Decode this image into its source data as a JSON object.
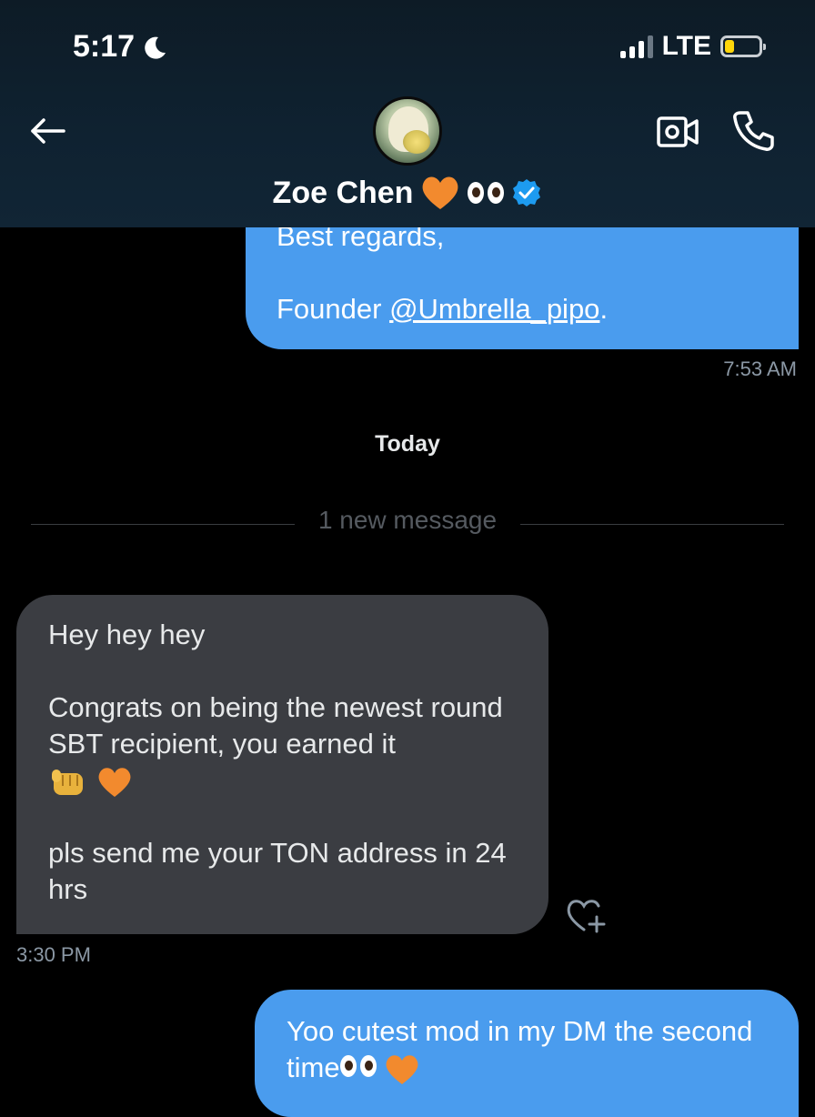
{
  "status_bar": {
    "time": "5:17",
    "network": "LTE",
    "battery_level": 0.24
  },
  "header": {
    "contact_name": "Zoe Chen",
    "name_emoji_icons": [
      "orange-heart-icon",
      "eyes-icon"
    ],
    "verified": true
  },
  "messages": [
    {
      "direction": "outgoing",
      "lines": [
        "Best regards,",
        "",
        "Founder @Umbrella_pipo."
      ],
      "line1": "Best regards,",
      "line2_prefix": "Founder ",
      "line2_link": "@Umbrella_pipo",
      "line2_suffix": ".",
      "time": "7:53 AM"
    },
    {
      "direction": "incoming",
      "p1": "Hey hey hey",
      "p2": "Congrats on being the newest round SBT recipient, you earned it",
      "p2_icons": [
        "fist-bump-icon",
        "orange-heart-icon"
      ],
      "p3": "pls send me your TON address in 24 hrs",
      "time": "3:30 PM"
    },
    {
      "direction": "outgoing",
      "text": "Yoo cutest mod in my DM the second time",
      "icons": [
        "eyes-icon",
        "orange-heart-icon"
      ]
    }
  ],
  "day_separator": "Today",
  "new_message_divider": "1 new message",
  "colors": {
    "outgoing_bubble": "#4a9cee",
    "incoming_bubble": "#3b3d42",
    "background": "#000000",
    "header_bg": "#0f2231",
    "verified_blue": "#1d9bf0",
    "heart_orange": "#f28a2e"
  }
}
